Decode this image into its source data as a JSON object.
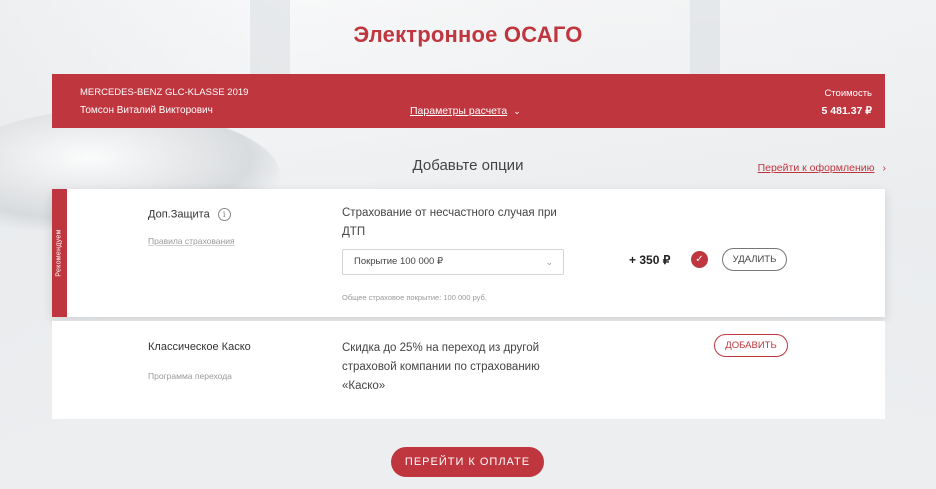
{
  "page": {
    "title": "Электронное ОСАГО"
  },
  "header": {
    "car": "MERCEDES-BENZ GLC-KLASSE 2019",
    "person": "Томсон Виталий Викторович",
    "params_link": "Параметры расчета",
    "cost_label": "Стоимость",
    "cost_value": "5 481.37 ₽"
  },
  "options": {
    "title": "Добавьте опции",
    "checkout_link": "Перейти к оформлению",
    "items": [
      {
        "ribbon": "Рекомендуем",
        "name": "Доп.Защита",
        "rules_link": "Правила страхования",
        "description": "Страхование от несчастного случая при ДТП",
        "select_value": "Покрытие 100 000 ₽",
        "coverage_note": "Общее страховое покрытие: 100 000 руб.",
        "price": "+ 350 ₽",
        "button": "УДАЛИТЬ"
      },
      {
        "name": "Классическое Каско",
        "rules_link": "Программа перехода",
        "description": "Скидка до 25% на переход из другой страховой компании по страхованию «Каско»",
        "button": "ДОБАВИТЬ"
      }
    ]
  },
  "footer": {
    "pay_button": "ПЕРЕЙТИ К ОПЛАТЕ"
  },
  "colors": {
    "accent": "#c0363f",
    "background": "#eceef0"
  },
  "icons": {
    "info": "info-icon",
    "check": "check-icon",
    "chevron_down": "chevron-down-icon",
    "chevron_right": "chevron-right-icon"
  }
}
